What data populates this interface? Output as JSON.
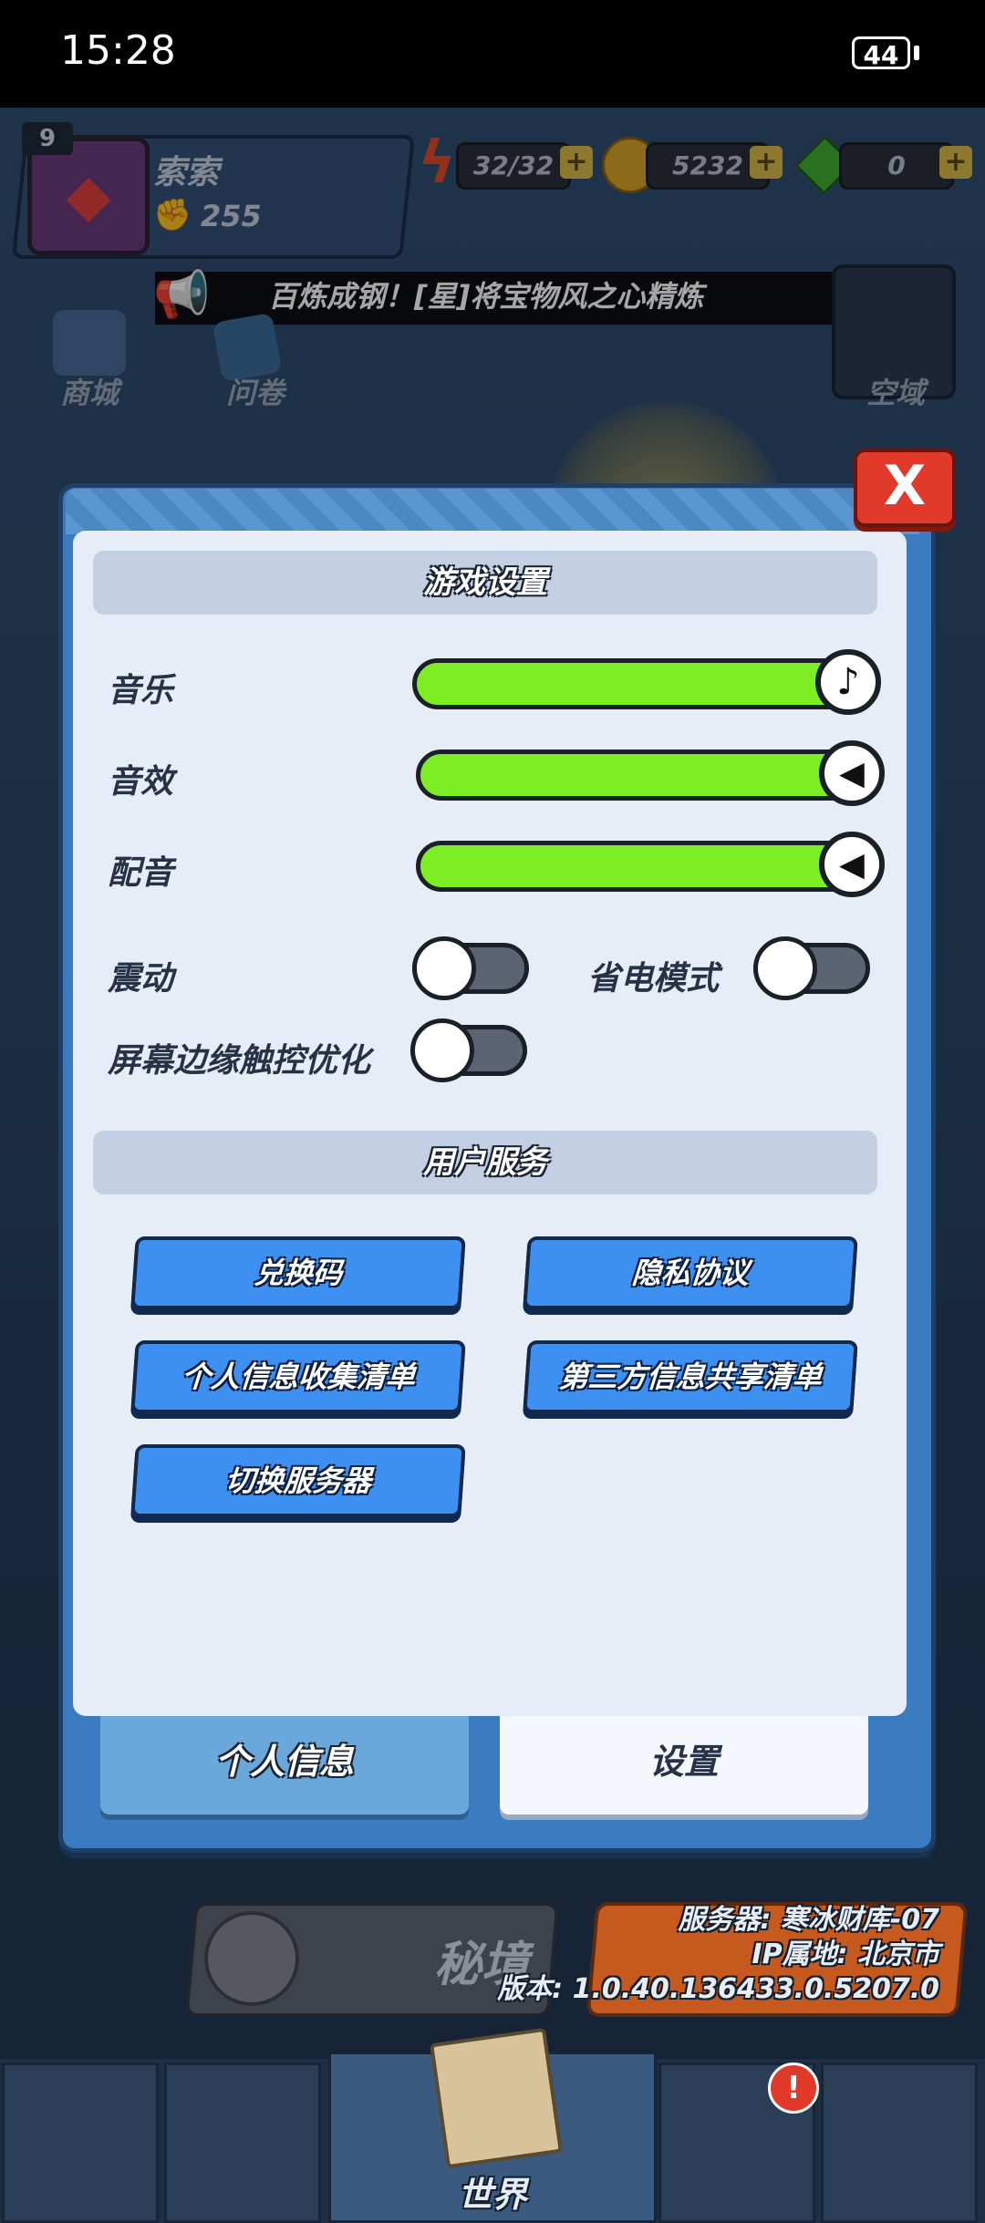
{
  "status_bar": {
    "time": "15:28",
    "battery": "44"
  },
  "player": {
    "level": "9",
    "name": "索索",
    "power": "255"
  },
  "resources": {
    "energy": "32/32",
    "coins": "5232",
    "gems": "0"
  },
  "announcement": {
    "text": "百炼成钢！[星]将宝物风之心精炼"
  },
  "side_buttons": {
    "shop": "商城",
    "survey": "问卷",
    "airspace": "空域"
  },
  "dialog": {
    "close_label": "X",
    "game_settings_title": "游戏设置",
    "music_label": "音乐",
    "sfx_label": "音效",
    "voice_label": "配音",
    "vibration_label": "震动",
    "power_save_label": "省电模式",
    "edge_touch_label": "屏幕边缘触控优化",
    "music_level": 1.0,
    "sfx_level": 1.0,
    "voice_level": 1.0,
    "vibration_on": false,
    "power_save_on": false,
    "edge_touch_on": false,
    "user_services_title": "用户服务",
    "buttons": {
      "redeem_code": "兑换码",
      "privacy_policy": "隐私协议",
      "personal_info_list": "个人信息收集清单",
      "third_party_list": "第三方信息共享清单",
      "switch_server": "切换服务器"
    },
    "tabs": {
      "profile": "个人信息",
      "settings": "设置"
    },
    "active_tab": "settings"
  },
  "lower": {
    "secret_realm": "秘境",
    "server": "服务器: 寒冰财库-07",
    "ip_location": "IP属地: 北京市",
    "version": "版本: 1.0.40.136433.0.5207.0"
  },
  "bottom_nav": {
    "world": "世界",
    "alert_badge": "!"
  },
  "colors": {
    "slider_fill": "#7ded24",
    "button_blue": "#3d8ff0",
    "close_red": "#e23a2a",
    "dialog_frame": "#3a7cbf",
    "panel_bg": "#e6edf6"
  }
}
